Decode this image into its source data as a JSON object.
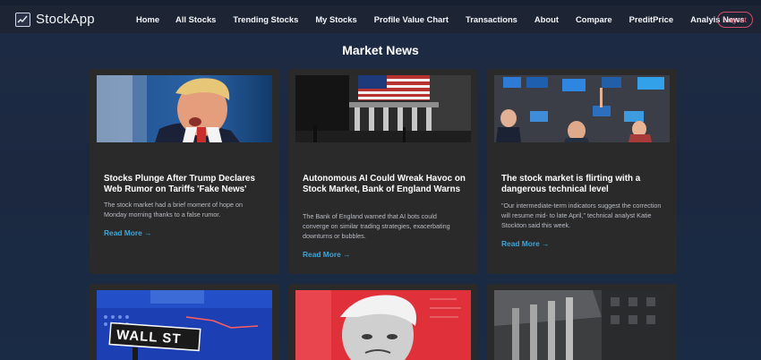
{
  "app": {
    "name": "StockApp"
  },
  "nav": {
    "links": [
      "Home",
      "All Stocks",
      "Trending Stocks",
      "My Stocks",
      "Profile Value Chart",
      "Transactions",
      "About",
      "Compare",
      "PreditPrice",
      "Analyis News"
    ],
    "logout_label": "Logout"
  },
  "page": {
    "title": "Market News"
  },
  "news": [
    {
      "title": "Stocks Plunge After Trump Declares Web Rumor on Tariffs 'Fake News'",
      "description": "The stock market had a brief moment of hope on Monday morning thanks to a false rumor.",
      "link_label": "Read More →"
    },
    {
      "title": "Autonomous AI Could Wreak Havoc on Stock Market, Bank of England Warns",
      "description": "The Bank of England warned that AI bots could converge on similar trading strategies, exacerbating downturns or bubbles.",
      "link_label": "Read More →"
    },
    {
      "title": "The stock market is flirting with a dangerous technical level",
      "description": "\"Our intermediate-term indicators suggest the correction will resume mid- to late April,\" technical analyst Katie Stockton said this week.",
      "link_label": "Read More →"
    }
  ],
  "second_row": {
    "wall_st_sign": "WALL ST"
  },
  "colors": {
    "accent_link": "#3aa6d9",
    "logout": "#e06a82",
    "card_bg": "#2a2a2b"
  }
}
